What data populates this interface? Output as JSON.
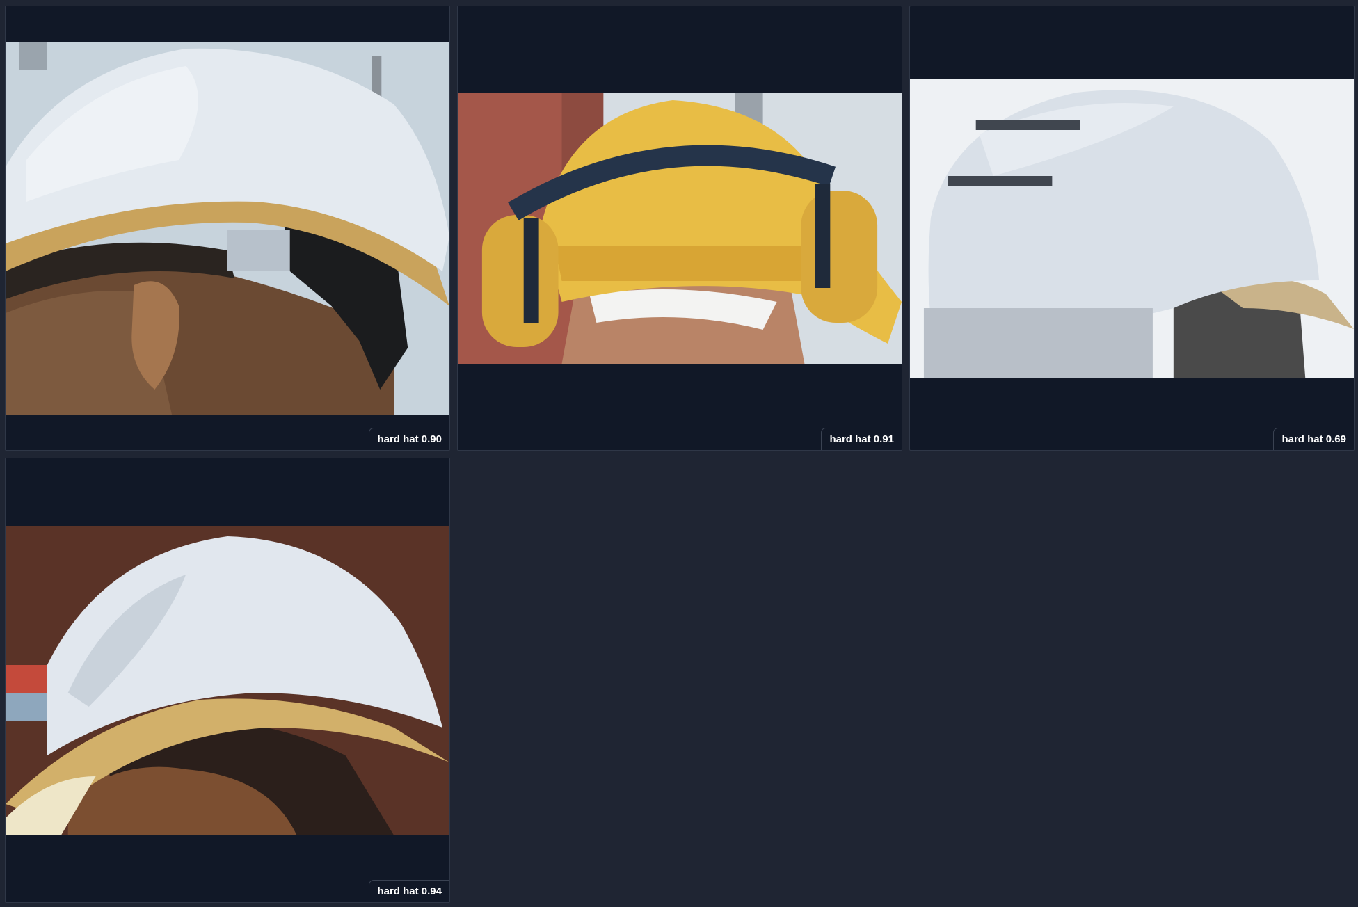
{
  "gallery": {
    "items": [
      {
        "label": "hard hat",
        "score": "0.90",
        "caption": "hard hat 0.90",
        "helmet_color": "#dfe6ee"
      },
      {
        "label": "hard hat",
        "score": "0.91",
        "caption": "hard hat 0.91",
        "helmet_color": "#e8bd45"
      },
      {
        "label": "hard hat",
        "score": "0.69",
        "caption": "hard hat 0.69",
        "helmet_color": "#d9e0e8"
      },
      {
        "label": "hard hat",
        "score": "0.94",
        "caption": "hard hat 0.94",
        "helmet_color": "#dfe6ee"
      }
    ]
  },
  "colors": {
    "page_background": "#1f2533",
    "tile_background": "#111827",
    "label_text": "#ffffff"
  }
}
